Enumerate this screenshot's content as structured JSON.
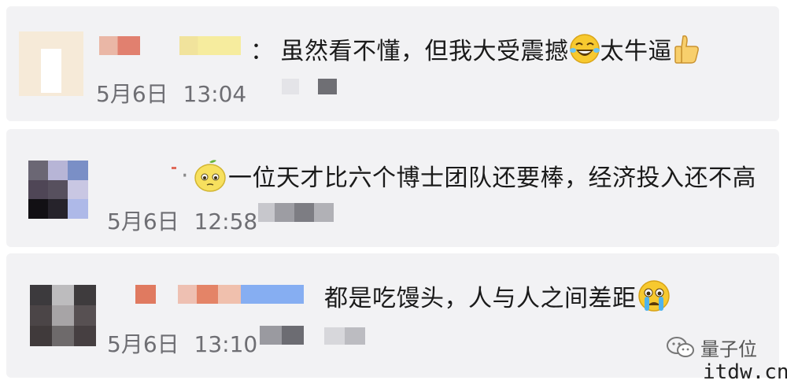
{
  "comments": [
    {
      "separator": "：",
      "message": "虽然看不懂，但我大受震撼",
      "message_after_emoji": "太牛逼",
      "emoji_1": "laughing-tears-icon",
      "emoji_2": "thumbs-up-icon",
      "date": "5月6日",
      "time": "13:04"
    },
    {
      "separator": "·",
      "emoji": "lemon-face-icon",
      "message": "一位天才比六个博士团队还要棒，经济投入还不高",
      "date": "5月6日",
      "time": "12:58"
    },
    {
      "message": "都是吃馒头，人与人之间差距",
      "emoji": "crying-face-icon",
      "date": "5月6日",
      "time": "13:10"
    }
  ],
  "watermark": {
    "icon": "wechat-icon",
    "text": "量子位"
  },
  "site_label": "itdw.cn",
  "colors": {
    "card_bg": "#f2f2f4",
    "timestamp": "#6e6e73",
    "text": "#1a1a1a"
  }
}
